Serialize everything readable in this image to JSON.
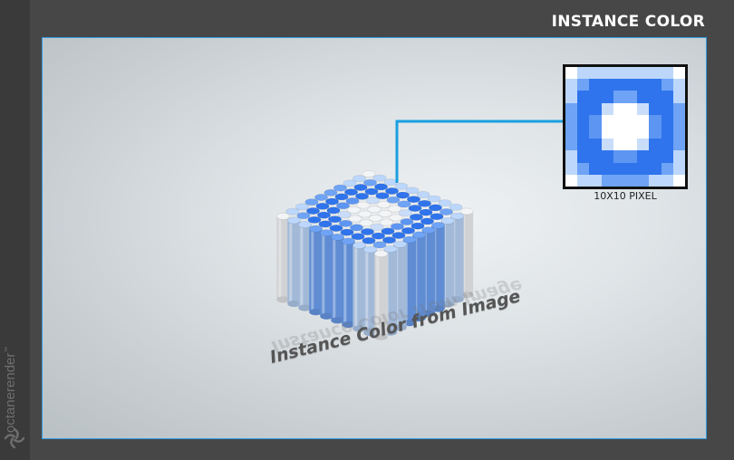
{
  "header": {
    "title": "INSTANCE COLOR"
  },
  "brand": {
    "name": "octanerender",
    "trademark": "™"
  },
  "scene": {
    "caption": "Instance Color from Image",
    "pixel_map_label": "10X10 PIXEL",
    "pixel_map": [
      [
        0,
        1,
        1,
        1,
        1,
        1,
        1,
        1,
        1,
        0
      ],
      [
        1,
        2,
        3,
        3,
        3,
        3,
        3,
        3,
        2,
        1
      ],
      [
        1,
        3,
        3,
        3,
        2,
        2,
        3,
        3,
        3,
        1
      ],
      [
        2,
        3,
        3,
        5,
        6,
        6,
        5,
        3,
        3,
        2
      ],
      [
        2,
        3,
        4,
        6,
        6,
        6,
        6,
        4,
        3,
        2
      ],
      [
        2,
        3,
        4,
        6,
        6,
        6,
        6,
        4,
        3,
        2
      ],
      [
        2,
        3,
        3,
        5,
        6,
        6,
        5,
        3,
        3,
        2
      ],
      [
        1,
        3,
        3,
        3,
        4,
        4,
        3,
        3,
        3,
        1
      ],
      [
        1,
        2,
        3,
        3,
        3,
        3,
        3,
        3,
        2,
        1
      ],
      [
        0,
        1,
        1,
        2,
        2,
        2,
        2,
        1,
        1,
        0
      ]
    ],
    "palette": [
      "#ffffff",
      "#bcd7fb",
      "#6ea3f5",
      "#2f74ec",
      "#5d95f2",
      "#c9ddfb",
      "#ffffff"
    ],
    "accent": "#1a9fe0"
  }
}
